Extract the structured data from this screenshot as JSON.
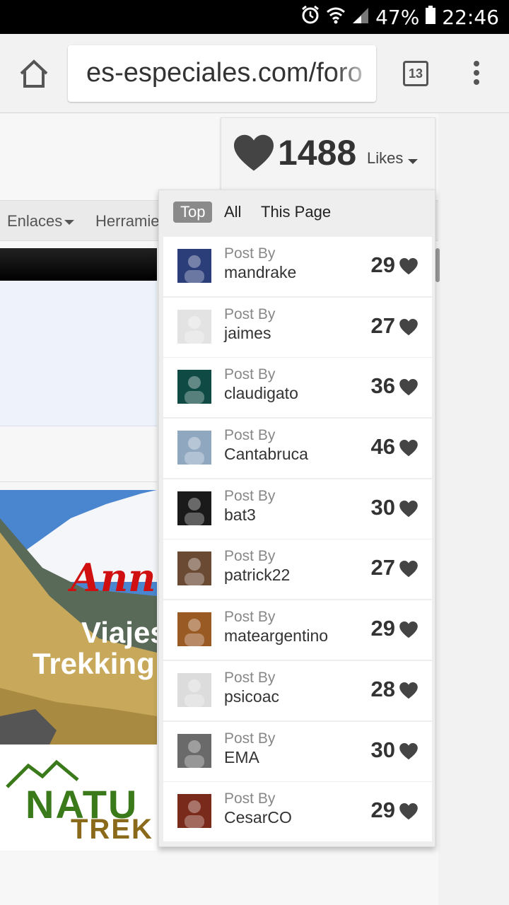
{
  "status": {
    "battery": "47%",
    "time": "22:46"
  },
  "browser": {
    "url": "es-especiales.com/foro",
    "tab_count": "13"
  },
  "nav": {
    "item1": "Enlaces",
    "item2": "Herramientas"
  },
  "ad": {
    "word1": "Ann",
    "line1": "Viajes",
    "line2": "Trekking",
    "logo1": "NATU",
    "logo2": "TREK"
  },
  "likes": {
    "count": "1488",
    "label": "Likes",
    "tabs": {
      "top": "Top",
      "all": "All",
      "page": "This Page"
    },
    "entries": [
      {
        "prefix": "Post By",
        "user": "mandrake",
        "count": "29",
        "avatar": "#2c3e7a"
      },
      {
        "prefix": "Post By",
        "user": "jaimes",
        "count": "27",
        "avatar": "#e3e3e3"
      },
      {
        "prefix": "Post By",
        "user": "claudigato",
        "count": "36",
        "avatar": "#0f4a44"
      },
      {
        "prefix": "Post By",
        "user": "Cantabruca",
        "count": "46",
        "avatar": "#8fa8c0"
      },
      {
        "prefix": "Post By",
        "user": "bat3",
        "count": "30",
        "avatar": "#1a1a1a"
      },
      {
        "prefix": "Post By",
        "user": "patrick22",
        "count": "27",
        "avatar": "#6b4a34"
      },
      {
        "prefix": "Post By",
        "user": "mateargentino",
        "count": "29",
        "avatar": "#9a5a24"
      },
      {
        "prefix": "Post By",
        "user": "psicoac",
        "count": "28",
        "avatar": "#dcdcdc"
      },
      {
        "prefix": "Post By",
        "user": "EMA",
        "count": "30",
        "avatar": "#6a6a6a"
      },
      {
        "prefix": "Post By",
        "user": "CesarCO",
        "count": "29",
        "avatar": "#7a2a1a"
      }
    ]
  }
}
